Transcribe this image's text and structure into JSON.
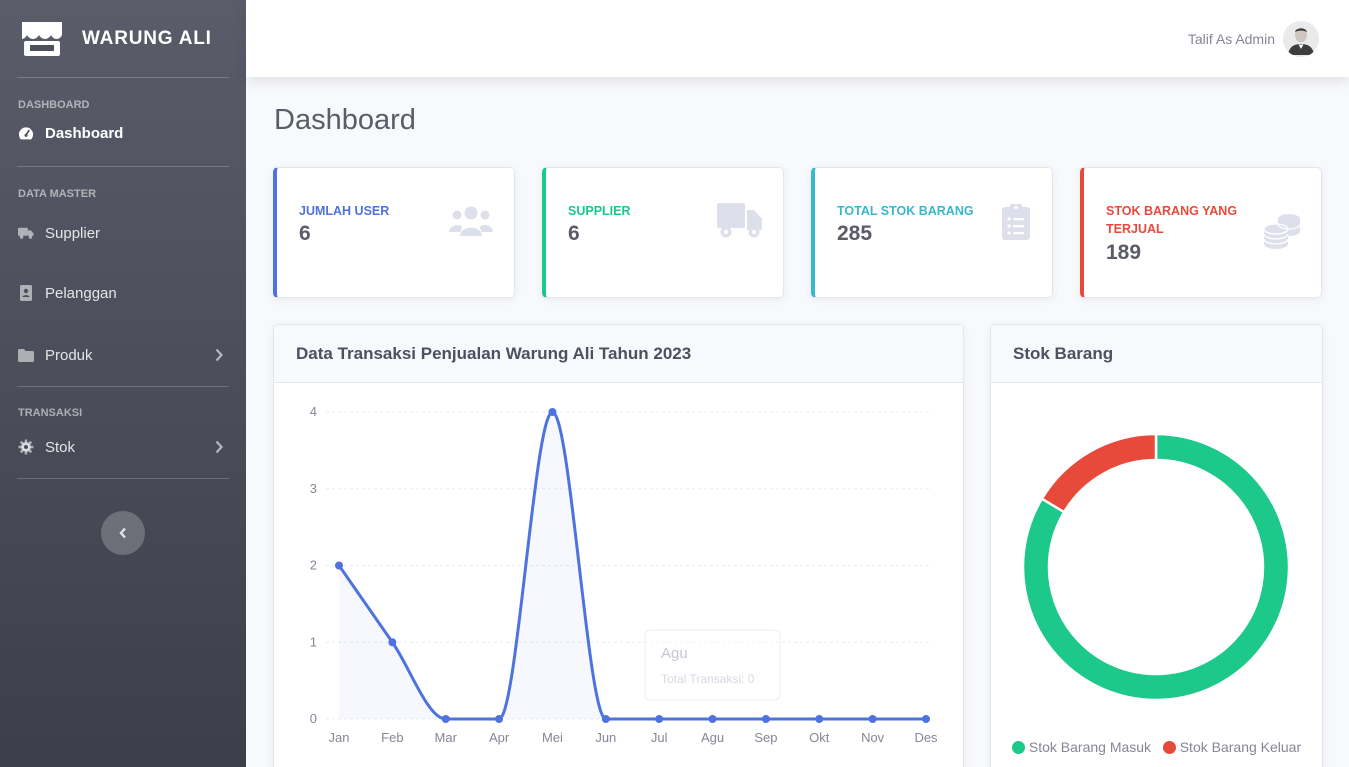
{
  "brand": {
    "name": "WARUNG ALI"
  },
  "sidebar": {
    "headings": {
      "dashboard": "DASHBOARD",
      "master": "DATA MASTER",
      "transaksi": "TRANSAKSI"
    },
    "items": [
      {
        "label": "Dashboard",
        "icon": "tachometer-icon"
      },
      {
        "label": "Supplier",
        "icon": "truck-icon"
      },
      {
        "label": "Pelanggan",
        "icon": "address-book-icon"
      },
      {
        "label": "Produk",
        "icon": "folder-icon"
      },
      {
        "label": "Stok",
        "icon": "gear-icon"
      }
    ]
  },
  "topbar": {
    "user": "Talif As Admin"
  },
  "page": {
    "title": "Dashboard"
  },
  "stats": [
    {
      "label": "JUMLAH USER",
      "value": "6",
      "color": "#4e73df",
      "icon": "users-icon"
    },
    {
      "label": "SUPPLIER",
      "value": "6",
      "color": "#1cc88a",
      "icon": "truck-icon"
    },
    {
      "label": "TOTAL STOK BARANG",
      "value": "285",
      "color": "#36b9cc",
      "icon": "clipboard-list-icon"
    },
    {
      "label": "STOK BARANG YANG TERJUAL",
      "value": "189",
      "color": "#e74a3b",
      "icon": "coins-icon"
    }
  ],
  "line_panel": {
    "title": "Data Transaksi Penjualan Warung Ali Tahun 2023"
  },
  "donut_panel": {
    "title": "Stok Barang"
  },
  "tooltip": {
    "title": "Agu",
    "body": "Total Transaksi: 0"
  },
  "chart_data": [
    {
      "type": "line",
      "categories": [
        "Jan",
        "Feb",
        "Mar",
        "Apr",
        "Mei",
        "Jun",
        "Jul",
        "Agu",
        "Sep",
        "Okt",
        "Nov",
        "Des"
      ],
      "series": [
        {
          "name": "Total Transaksi",
          "values": [
            2,
            1,
            0,
            0,
            4,
            0,
            0,
            0,
            0,
            0,
            0,
            0
          ]
        }
      ],
      "ylim": [
        0,
        4
      ],
      "yticks": [
        0,
        1,
        2,
        3,
        4
      ],
      "color": "#4e73df",
      "grid": true
    },
    {
      "type": "pie",
      "donut": true,
      "series": [
        {
          "name": "Stok Barang Masuk",
          "value": 285,
          "color": "#1cc88a"
        },
        {
          "name": "Stok Barang Keluar",
          "value": 56,
          "color": "#e74a3b"
        }
      ],
      "legend": "bottom"
    }
  ]
}
